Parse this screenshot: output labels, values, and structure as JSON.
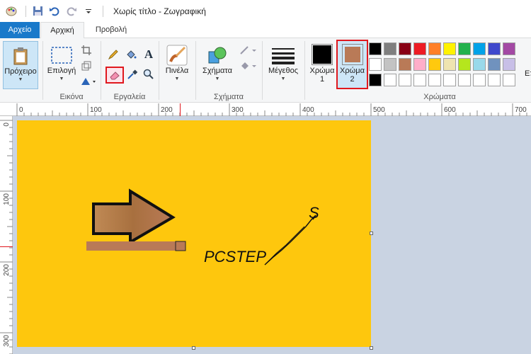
{
  "window": {
    "title": "Χωρίς τίτλο - Ζωγραφική"
  },
  "tabs": {
    "file": "Αρχείο",
    "home": "Αρχική",
    "view": "Προβολή"
  },
  "ribbon": {
    "clipboard": {
      "label": "Πρόχειρο"
    },
    "image": {
      "select_label": "Επιλογή",
      "group_label": "Εικόνα"
    },
    "tools": {
      "group_label": "Εργαλεία"
    },
    "brushes": {
      "label": "Πινέλα"
    },
    "shapes": {
      "label": "Σχήματα",
      "group_label": "Σχήματα"
    },
    "size": {
      "label": "Μέγεθος"
    },
    "colors": {
      "color1_label_a": "Χρώμα",
      "color1_label_b": "1",
      "color2_label_a": "Χρώμα",
      "color2_label_b": "2",
      "group_label": "Χρώματα",
      "edit_label_partial": "Επ",
      "color1": "#000000",
      "color2": "#b97a57",
      "palette_row1": [
        "#000000",
        "#7f7f7f",
        "#880015",
        "#ed1c24",
        "#ff7f27",
        "#fff200",
        "#22b14c",
        "#00a2e8",
        "#3f48cc",
        "#a349a4"
      ],
      "palette_row2": [
        "#ffffff",
        "#c3c3c3",
        "#b97a57",
        "#ffaec9",
        "#ffc90e",
        "#efe4b0",
        "#b5e61d",
        "#99d9ea",
        "#7092be",
        "#c8bfe7"
      ],
      "palette_row3": [
        "#000000",
        "#ffffff",
        "#ffffff",
        "#ffffff",
        "#ffffff",
        "#ffffff",
        "#ffffff",
        "#ffffff",
        "#ffffff",
        "#ffffff"
      ]
    }
  },
  "rulers": {
    "h_ticks": [
      "0",
      "100",
      "200",
      "300",
      "400",
      "500",
      "600",
      "700"
    ],
    "v_ticks": [
      "0",
      "100",
      "200",
      "300"
    ]
  },
  "canvas": {
    "background": "#fec70d",
    "text_pcstep": "PCSTEP",
    "text_s": "S"
  }
}
